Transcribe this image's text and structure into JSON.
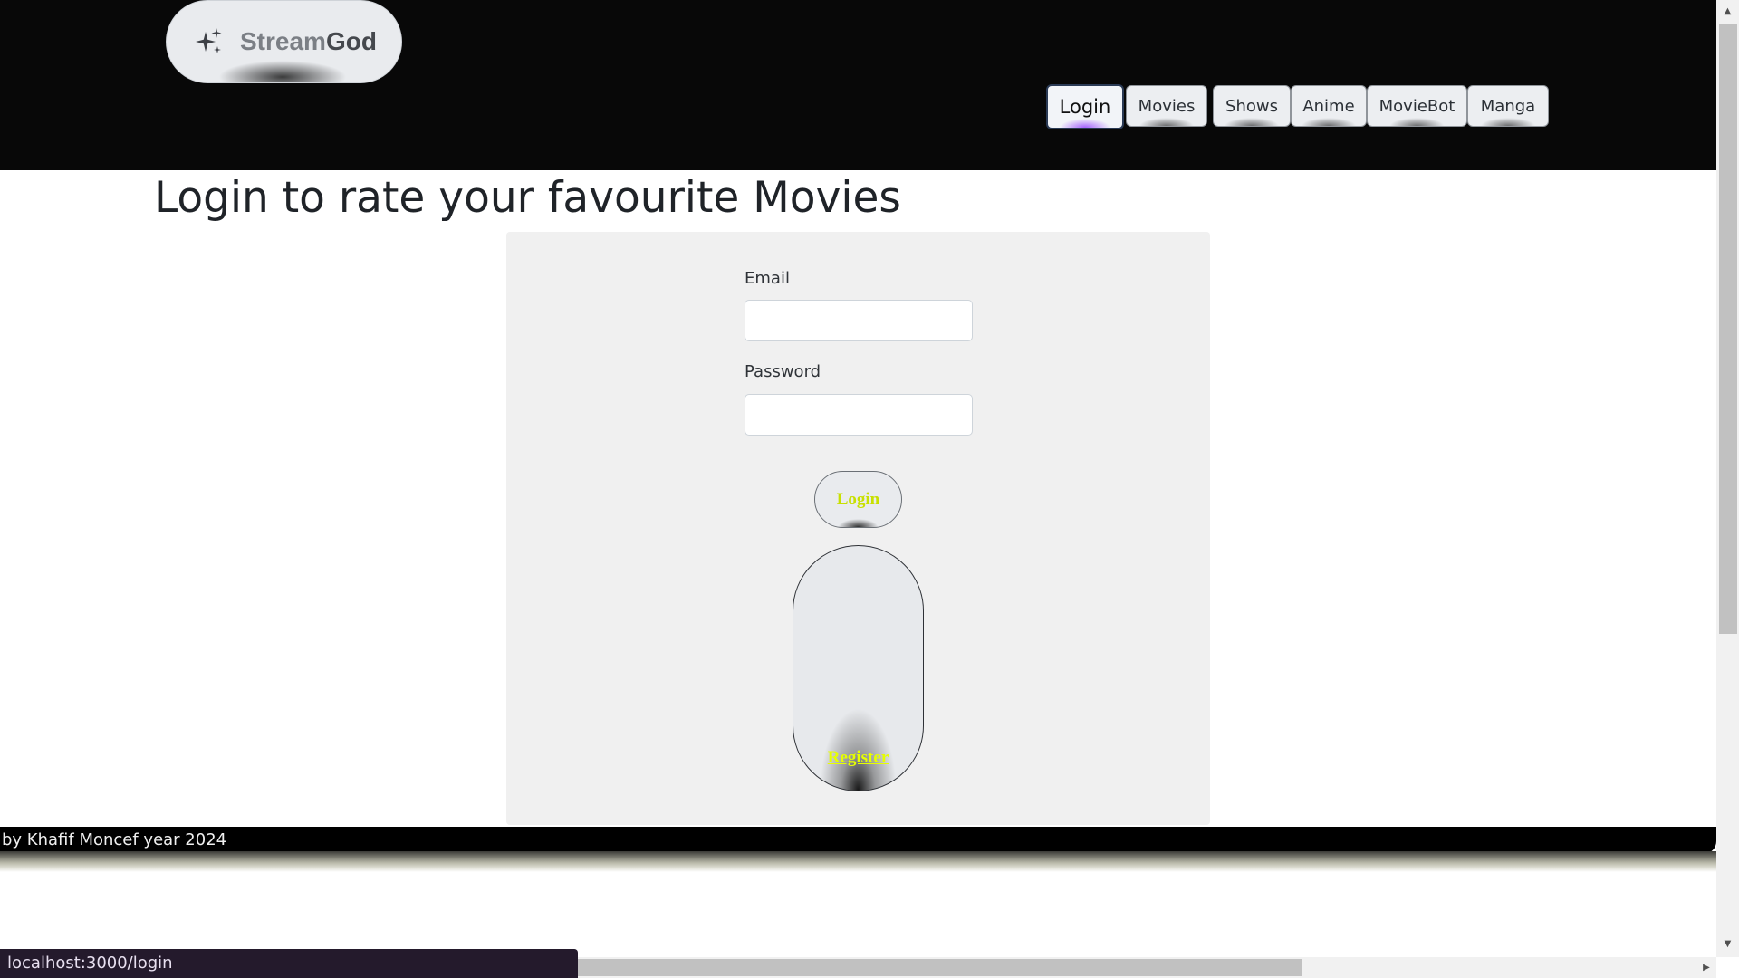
{
  "header": {
    "brand": {
      "icon": "sparkles-icon",
      "text_part1": "Stream",
      "text_part2": "God"
    },
    "nav": [
      {
        "label": "Login",
        "active": true
      },
      {
        "label": "Movies",
        "active": false
      },
      {
        "label": "Shows",
        "active": false
      },
      {
        "label": "Anime",
        "active": false
      },
      {
        "label": "MovieBot",
        "active": false
      },
      {
        "label": "Manga",
        "active": false
      }
    ]
  },
  "main": {
    "heading": "Login to rate your favourite Movies",
    "form": {
      "email_label": "Email",
      "email_value": "",
      "password_label": "Password",
      "password_value": "",
      "login_button": "Login",
      "register_link": "Register"
    }
  },
  "footer": {
    "text": "by Khafif Moncef year 2024"
  },
  "status_bar": {
    "url": "localhost:3000/login"
  },
  "colors": {
    "header_bg": "#080808",
    "button_text": "#c8e000",
    "register_text": "#e6ff00",
    "active_glow": "#9b50ff"
  }
}
